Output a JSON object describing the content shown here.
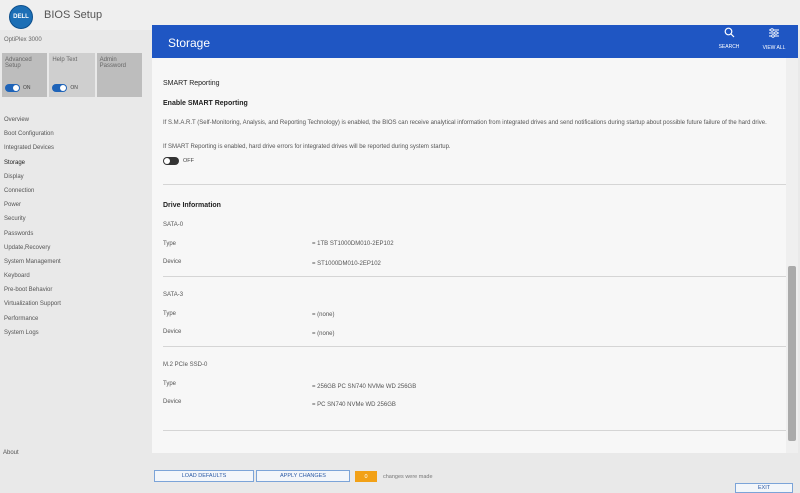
{
  "app": {
    "brand": "DELL",
    "title": "BIOS Setup",
    "model": "OptiPlex 3000"
  },
  "tiles": [
    {
      "label": "Advanced Setup",
      "state": "ON"
    },
    {
      "label": "Help Text",
      "state": "ON"
    },
    {
      "label": "Admin Password",
      "state": ""
    }
  ],
  "nav": [
    "Overview",
    "Boot Configuration",
    "Integrated Devices",
    "Storage",
    "Display",
    "Connection",
    "Power",
    "Security",
    "Passwords",
    "Update,Recovery",
    "System Management",
    "Keyboard",
    "Pre-boot Behavior",
    "Virtualization Support",
    "Performance",
    "System Logs"
  ],
  "about": "About",
  "header": {
    "title": "Storage",
    "search_label": "SEARCH",
    "viewall_label": "VIEW ALL"
  },
  "smart": {
    "section_title": "SMART Reporting",
    "subtitle": "Enable SMART Reporting",
    "desc1": "If S.M.A.R.T (Self-Monitoring, Analysis, and Reporting Technology) is enabled, the BIOS can receive analytical information from integrated drives and send notifications during startup about possible future failure of the hard drive.",
    "desc2": "If SMART Reporting is enabled, hard drive errors for integrated drives will be reported during system startup.",
    "toggle_state": "OFF"
  },
  "drive_info": {
    "title": "Drive Information",
    "drives": [
      {
        "name": "SATA-0",
        "type_key": "Type",
        "type_val": "= 1TB ST1000DM010-2EP102",
        "device_key": "Device",
        "device_val": "= ST1000DM010-2EP102"
      },
      {
        "name": "SATA-3",
        "type_key": "Type",
        "type_val": "= (none)",
        "device_key": "Device",
        "device_val": "= (none)"
      },
      {
        "name": "M.2 PCIe SSD-0",
        "type_key": "Type",
        "type_val": "= 256GB PC SN740 NVMe WD 256GB",
        "device_key": "Device",
        "device_val": "= PC SN740 NVMe WD 256GB"
      }
    ]
  },
  "footer": {
    "load_defaults": "LOAD DEFAULTS",
    "apply_changes": "APPLY CHANGES",
    "change_count": "0",
    "changes_text": "changes were made",
    "exit": "EXIT"
  },
  "colors": {
    "header_blue": "#1f56c3",
    "toggle_blue": "#1e63b8",
    "counter_orange": "#f2a117"
  }
}
